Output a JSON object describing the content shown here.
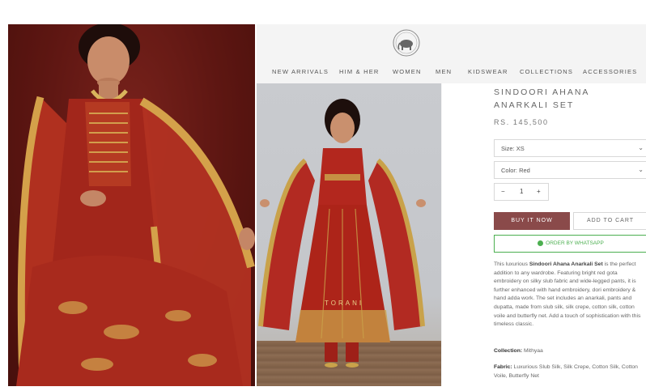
{
  "brand": {
    "logo_icon": "torani-elephant-logo-icon"
  },
  "nav": {
    "items": [
      "NEW ARRIVALS",
      "HIM & HER",
      "WOMEN",
      "MEN",
      "KIDSWEAR",
      "COLLECTIONS",
      "ACCESSORIES"
    ]
  },
  "product": {
    "title": "SINDOORI AHANA ANARKALI SET",
    "price": "RS. 145,500",
    "size_select": "Size: XS",
    "color_select": "Color: Red",
    "quantity": "1",
    "qty_minus": "−",
    "qty_plus": "+",
    "buy_now": "BUY IT NOW",
    "add_to_cart": "ADD TO CART",
    "whatsapp": "ORDER BY WHATSAPP",
    "description_prefix": "This luxurious ",
    "description_name": "Sindoori Ahana Anarkali Set",
    "description_rest": " is the perfect addition to any wardrobe. Featuring bright red gota embroidery on silky slub fabric and wide-legged pants, it is further enhanced with hand embroidery, dori embroidery & hand adda work. The set includes an anarkali, pants and dupatta, made from slub silk, silk crepe, cotton silk, cotton voile and butterfly net. Add a touch of sophistication with this timeless classic.",
    "collection_label": "Collection:",
    "collection_value": " Mithyaa",
    "fabric_label": "Fabric:",
    "fabric_value": " Luxurious Slub Silk, Silk Crepe, Cotton Silk, Cotton Voile, Butterfly Net"
  },
  "photo_text": "TORANI",
  "colors": {
    "accent": "#8a4a4a",
    "whatsapp": "#4caf50",
    "garment_red": "#a8281f",
    "gold": "#c9a24a"
  }
}
